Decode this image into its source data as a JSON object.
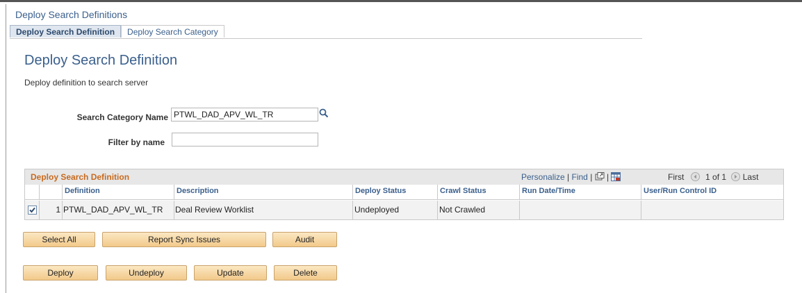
{
  "app_title": "Deploy Search Definitions",
  "tabs": [
    {
      "label": "Deploy Search Definition",
      "active": true
    },
    {
      "label": "Deploy Search Category",
      "active": false
    }
  ],
  "page": {
    "title": "Deploy Search Definition",
    "description": "Deploy definition to search server"
  },
  "form": {
    "category_label": "Search Category Name",
    "category_value": "PTWL_DAD_APV_WL_TR",
    "filter_label": "Filter by name",
    "filter_value": ""
  },
  "grid": {
    "title": "Deploy Search Definition",
    "personalize": "Personalize",
    "find": "Find",
    "separator": "|",
    "first": "First",
    "range": "1 of 1",
    "last": "Last",
    "columns": [
      "Definition",
      "Description",
      "Deploy Status",
      "Crawl Status",
      "Run Date/Time",
      "User/Run Control ID"
    ],
    "rows": [
      {
        "checked": true,
        "num": "1",
        "definition": "PTWL_DAD_APV_WL_TR",
        "description": "Deal Review Worklist",
        "deploy_status": "Undeployed",
        "crawl_status": "Not Crawled",
        "run_datetime": "",
        "user_run_control_id": ""
      }
    ]
  },
  "buttons": {
    "select_all": "Select All",
    "report_sync": "Report Sync Issues",
    "audit": "Audit",
    "deploy": "Deploy",
    "undeploy": "Undeploy",
    "update": "Update",
    "delete": "Delete"
  },
  "colors": {
    "title_blue": "#3a5f8c",
    "grid_title_orange": "#c86a1e",
    "button_fill": "#f2c98a"
  }
}
